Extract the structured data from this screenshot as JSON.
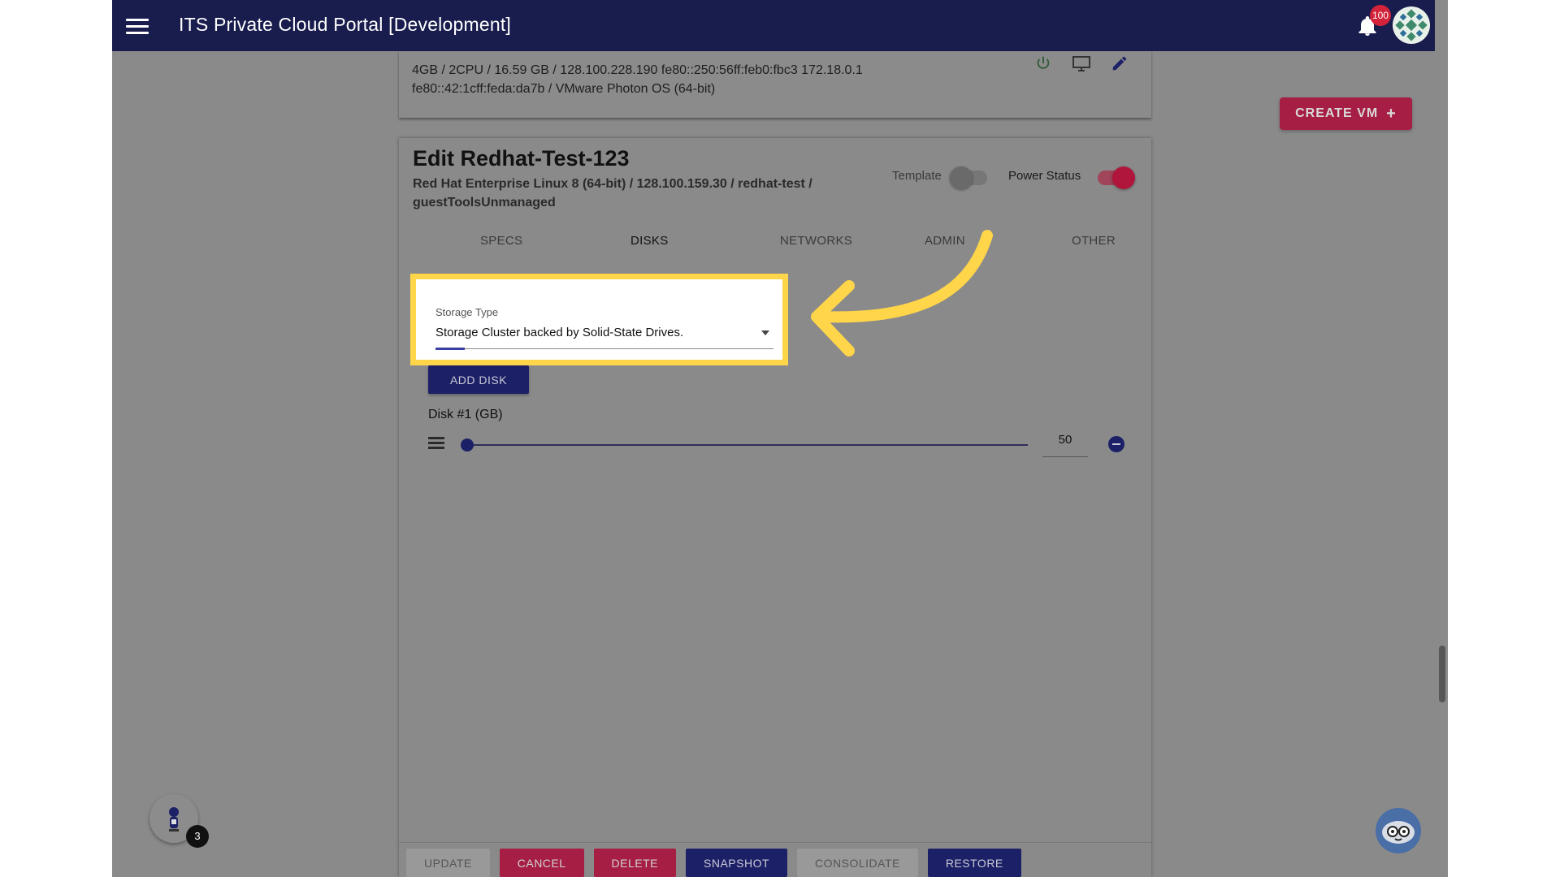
{
  "header": {
    "title": "ITS Private Cloud Portal [Development]",
    "notification_count": "100"
  },
  "actions": {
    "create_vm": "CREATE VM"
  },
  "vm_summary": {
    "line1": "4GB / 2CPU / 16.59 GB / 128.100.228.190 fe80::250:56ff:feb0:fbc3 172.18.0.1",
    "line2": "fe80::42:1cff:feda:da7b / VMware Photon OS (64-bit)"
  },
  "edit": {
    "title": "Edit Redhat-Test-123",
    "subtitle": "Red Hat Enterprise Linux 8 (64-bit) / 128.100.159.30 / redhat-test / guestToolsUnmanaged",
    "template_label": "Template",
    "template_on": false,
    "power_label": "Power Status",
    "power_on": true,
    "tabs": [
      {
        "label": "SPECS",
        "active": false
      },
      {
        "label": "DISKS",
        "active": true
      },
      {
        "label": "NETWORKS",
        "active": false
      },
      {
        "label": "ADMIN",
        "active": false
      },
      {
        "label": "OTHER",
        "active": false
      }
    ],
    "storage_type_label": "Storage Type",
    "storage_type_value": "Storage Cluster backed by Solid-State Drives.",
    "add_disk": "ADD DISK",
    "disks": [
      {
        "label": "Disk #1 (GB)",
        "value": "50"
      }
    ],
    "buttons": {
      "update": "UPDATE",
      "cancel": "CANCEL",
      "delete": "DELETE",
      "snapshot": "SNAPSHOT",
      "consolidate": "CONSOLIDATE",
      "restore": "RESTORE"
    }
  },
  "helper": {
    "count": "3"
  },
  "colors": {
    "header": "#191d4e",
    "primary": "#1c2167",
    "accent": "#a61e43",
    "highlight": "#ffd54a"
  }
}
